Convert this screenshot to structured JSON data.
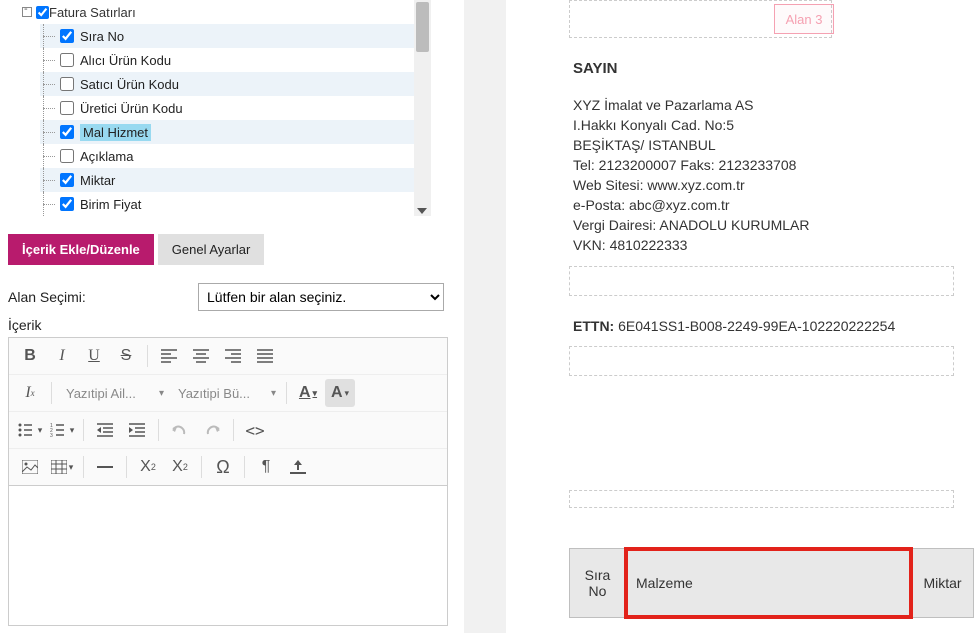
{
  "tree": {
    "parent_label": "Fatura Satırları",
    "items": [
      {
        "label": "Sıra No",
        "checked": true
      },
      {
        "label": "Alıcı Ürün Kodu",
        "checked": false
      },
      {
        "label": "Satıcı Ürün Kodu",
        "checked": false
      },
      {
        "label": "Üretici Ürün Kodu",
        "checked": false
      },
      {
        "label": "Mal Hizmet",
        "checked": true,
        "selected": true
      },
      {
        "label": "Açıklama",
        "checked": false
      },
      {
        "label": "Miktar",
        "checked": true
      },
      {
        "label": "Birim Fiyat",
        "checked": true
      }
    ]
  },
  "tabs": {
    "active": "İçerik Ekle/Düzenle",
    "inactive": "Genel Ayarlar"
  },
  "form": {
    "alan_secimi_label": "Alan Seçimi:",
    "alan_secimi_placeholder": "Lütfen bir alan seçiniz.",
    "icerik_label": "İçerik"
  },
  "editor": {
    "font_family_placeholder": "Yazıtipi Ail...",
    "font_size_placeholder": "Yazıtipi Bü..."
  },
  "preview": {
    "alan3": "Alan 3",
    "sayin_title": "SAYIN",
    "company": "XYZ İmalat ve Pazarlama AS",
    "address1": "I.Hakkı Konyalı Cad.  No:5",
    "address2": "BEŞİKTAŞ/ ISTANBUL",
    "tel_faks": "Tel: 2123200007 Faks: 2123233708",
    "web": "Web Sitesi: www.xyz.com.tr",
    "eposta": "e-Posta: abc@xyz.com.tr",
    "vergi": "Vergi Dairesi: ANADOLU KURUMLAR",
    "vkn": "VKN: 4810222333",
    "ettn_label": "ETTN:",
    "ettn_value": "6E041SS1-B008-2249-99EA-102220222254",
    "table": {
      "col1": "Sıra No",
      "col2": "Malzeme",
      "col3": "Miktar"
    }
  }
}
